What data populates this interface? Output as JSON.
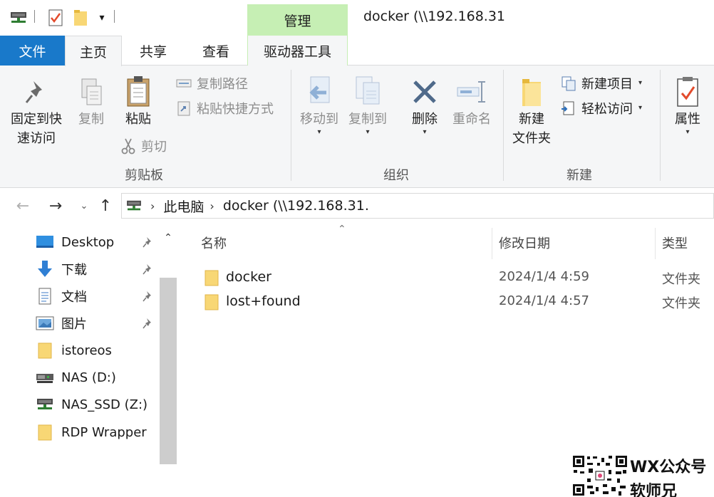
{
  "window": {
    "title": "docker (\\\\192.168.31",
    "context_tab": "管理"
  },
  "ribbon_tabs": {
    "file": "文件",
    "home": "主页",
    "share": "共享",
    "view": "查看",
    "drive_tools": "驱动器工具"
  },
  "ribbon": {
    "clipboard": {
      "group": "剪贴板",
      "pin_line1": "固定到快",
      "pin_line2": "速访问",
      "copy": "复制",
      "paste": "粘贴",
      "copy_path": "复制路径",
      "paste_shortcut": "粘贴快捷方式",
      "cut": "剪切"
    },
    "organize": {
      "group": "组织",
      "move_to": "移动到",
      "copy_to": "复制到",
      "delete": "删除",
      "rename": "重命名"
    },
    "new": {
      "group": "新建",
      "new_folder_line1": "新建",
      "new_folder_line2": "文件夹",
      "new_item": "新建项目",
      "easy_access": "轻松访问"
    },
    "open": {
      "properties": "属性"
    }
  },
  "address": {
    "segments": [
      "此电脑",
      "docker (\\\\192.168.31."
    ]
  },
  "nav_pane": {
    "items": [
      {
        "label": "Desktop",
        "icon": "desktop-icon",
        "pinned": true
      },
      {
        "label": "下载",
        "icon": "download-icon",
        "pinned": true
      },
      {
        "label": "文档",
        "icon": "document-icon",
        "pinned": true
      },
      {
        "label": "图片",
        "icon": "pictures-icon",
        "pinned": true
      },
      {
        "label": "istoreos",
        "icon": "folder-icon",
        "pinned": false
      },
      {
        "label": "NAS (D:)",
        "icon": "network-drive-icon",
        "pinned": false
      },
      {
        "label": "NAS_SSD (Z:)",
        "icon": "network-drive-icon",
        "pinned": false
      },
      {
        "label": "RDP Wrapper",
        "icon": "folder-icon",
        "pinned": false
      }
    ]
  },
  "file_list": {
    "columns": {
      "name": "名称",
      "modified": "修改日期",
      "type": "类型"
    },
    "rows": [
      {
        "name": "docker",
        "modified": "2024/1/4 4:59",
        "type": "文件夹"
      },
      {
        "name": "lost+found",
        "modified": "2024/1/4 4:57",
        "type": "文件夹"
      }
    ]
  },
  "watermark": {
    "line1": "WX公众号",
    "line2": "软师兄"
  },
  "colors": {
    "file_tab": "#1979ca",
    "manage_tab": "#c6efb4",
    "ribbon_bg": "#f5f6f7",
    "folder": "#f8d775"
  }
}
